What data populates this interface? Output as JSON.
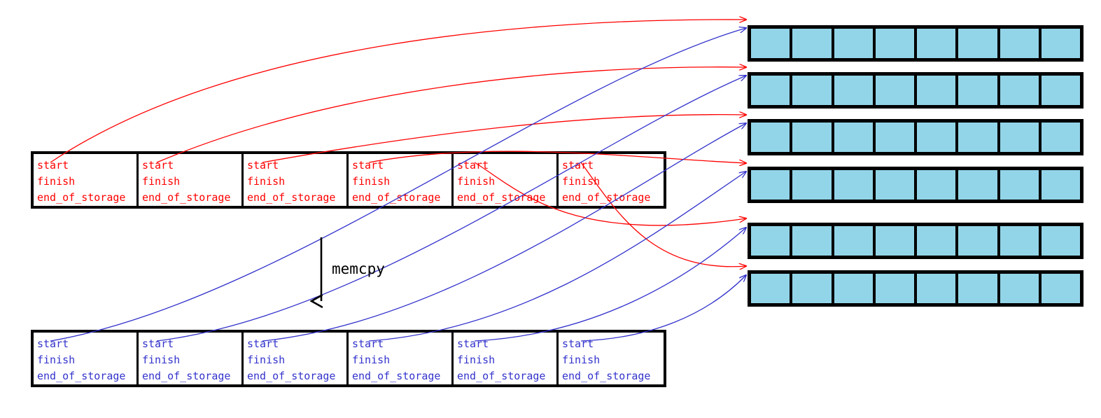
{
  "diagram": {
    "title": "vector of vectors memcpy reallocation",
    "operation_label": "memcpy",
    "colors": {
      "source_text": "#ff0000",
      "dest_text": "#3333cc",
      "heap_cell_fill": "#93d5e8",
      "border": "#000000",
      "arrow_source": "#ff0000",
      "arrow_dest": "#3333cc",
      "memcpy_arrow": "#000000"
    }
  },
  "source_row": {
    "name": "old-vector-array",
    "count": 6,
    "fields": [
      "start",
      "finish",
      "end_of_storage"
    ],
    "boxes": [
      {
        "start": "start",
        "finish": "finish",
        "end_of_storage": "end_of_storage"
      },
      {
        "start": "start",
        "finish": "finish",
        "end_of_storage": "end_of_storage"
      },
      {
        "start": "start",
        "finish": "finish",
        "end_of_storage": "end_of_storage"
      },
      {
        "start": "start",
        "finish": "finish",
        "end_of_storage": "end_of_storage"
      },
      {
        "start": "start",
        "finish": "finish",
        "end_of_storage": "end_of_storage"
      },
      {
        "start": "start",
        "finish": "finish",
        "end_of_storage": "end_of_storage"
      }
    ]
  },
  "dest_row": {
    "name": "new-vector-array",
    "count": 6,
    "fields": [
      "start",
      "finish",
      "end_of_storage"
    ],
    "boxes": [
      {
        "start": "start",
        "finish": "finish",
        "end_of_storage": "end_of_storage"
      },
      {
        "start": "start",
        "finish": "finish",
        "end_of_storage": "end_of_storage"
      },
      {
        "start": "start",
        "finish": "finish",
        "end_of_storage": "end_of_storage"
      },
      {
        "start": "start",
        "finish": "finish",
        "end_of_storage": "end_of_storage"
      },
      {
        "start": "start",
        "finish": "finish",
        "end_of_storage": "end_of_storage"
      },
      {
        "start": "start",
        "finish": "finish",
        "end_of_storage": "end_of_storage"
      }
    ]
  },
  "heap_blocks": {
    "name": "heap-buffers",
    "count": 6,
    "cells_per_block": 8,
    "blocks": [
      {
        "index": 0,
        "cells": 8
      },
      {
        "index": 1,
        "cells": 8
      },
      {
        "index": 2,
        "cells": 8
      },
      {
        "index": 3,
        "cells": 8
      },
      {
        "index": 4,
        "cells": 8
      },
      {
        "index": 5,
        "cells": 8
      }
    ]
  },
  "arrows": {
    "source_to_heap_count": 6,
    "dest_to_heap_count": 6,
    "memcpy_arrow_label": "memcpy"
  }
}
